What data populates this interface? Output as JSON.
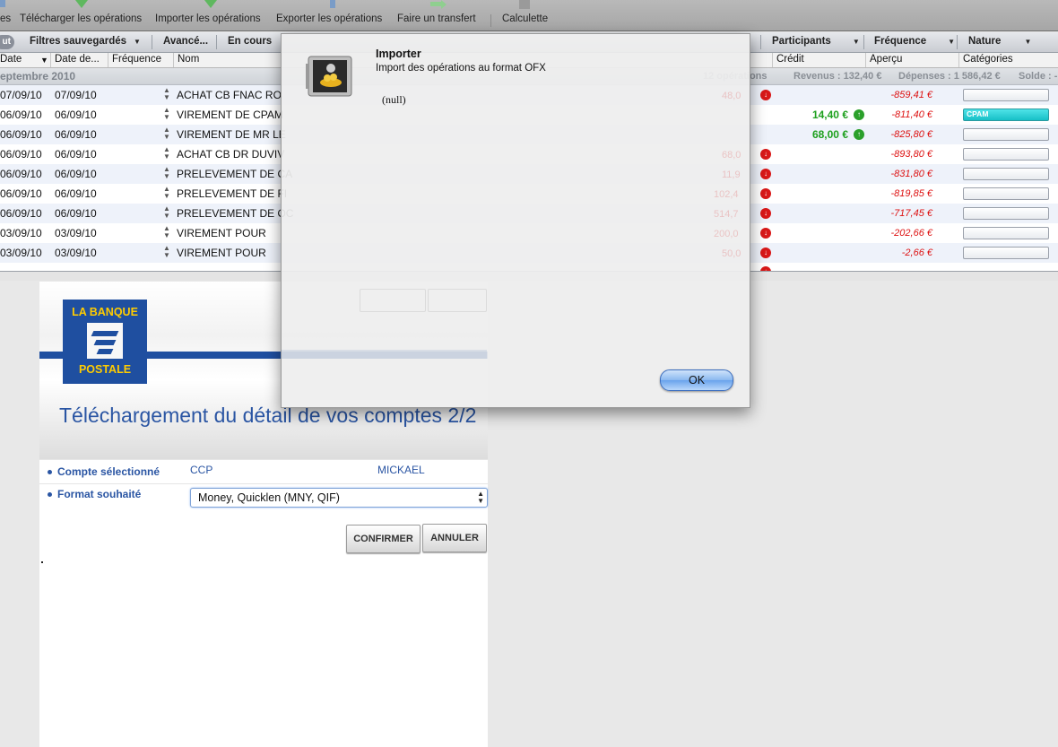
{
  "toolbar": {
    "items": [
      "es",
      "Télécharger les opérations",
      "Importer les opérations",
      "Exporter les opérations",
      "Faire un transfert",
      "Calculette"
    ]
  },
  "filterbar": {
    "pill": "ut",
    "saved_filters": "Filtres sauvegardés",
    "advanced": "Avancé...",
    "in_progress": "En cours",
    "participants": "Participants",
    "frequency": "Fréquence",
    "nature": "Nature"
  },
  "columns": {
    "date": "Date",
    "date_value": "Date de...",
    "frequency": "Fréquence",
    "name": "Nom",
    "credit": "Crédit",
    "preview": "Aperçu",
    "categories": "Catégories"
  },
  "month": {
    "label": "eptembre 2010",
    "ops": "12 opérations",
    "revenue": "Revenus : 132,40 €",
    "expenses": "Dépenses : 1 586,42 €",
    "balance": "Solde : -"
  },
  "rows": [
    {
      "date": "07/09/10",
      "date2": "07/09/10",
      "name": "ACHAT CB FNAC RO",
      "ghost_amount": "48,0",
      "credit": "",
      "balance": "-859,41 €",
      "category": ""
    },
    {
      "date": "06/09/10",
      "date2": "06/09/10",
      "name": "VIREMENT DE CPAM",
      "ghost_amount": "",
      "credit": "14,40 €",
      "balance": "-811,40 €",
      "category": "CPAM"
    },
    {
      "date": "06/09/10",
      "date2": "06/09/10",
      "name": "VIREMENT DE MR LE",
      "ghost_amount": "",
      "credit": "68,00 €",
      "balance": "-825,80 €",
      "category": ""
    },
    {
      "date": "06/09/10",
      "date2": "06/09/10",
      "name": "ACHAT CB DR DUVIV",
      "ghost_amount": "68,0",
      "credit": "",
      "balance": "-893,80 €",
      "category": ""
    },
    {
      "date": "06/09/10",
      "date2": "06/09/10",
      "name": "PRELEVEMENT DE CA",
      "ghost_amount": "11,9",
      "credit": "",
      "balance": "-831,80 €",
      "category": ""
    },
    {
      "date": "06/09/10",
      "date2": "06/09/10",
      "name": "PRELEVEMENT DE FI",
      "ghost_amount": "102,4",
      "credit": "",
      "balance": "-819,85 €",
      "category": ""
    },
    {
      "date": "06/09/10",
      "date2": "06/09/10",
      "name": "PRELEVEMENT DE OC",
      "ghost_amount": "514,7",
      "credit": "",
      "balance": "-717,45 €",
      "category": ""
    },
    {
      "date": "03/09/10",
      "date2": "03/09/10",
      "name": "VIREMENT POUR",
      "ghost_amount": "200,0",
      "credit": "",
      "balance": "-202,66 €",
      "category": ""
    },
    {
      "date": "03/09/10",
      "date2": "03/09/10",
      "name": "VIREMENT POUR",
      "ghost_amount": "50,0",
      "credit": "",
      "balance": "-2,66 €",
      "category": ""
    }
  ],
  "dialog": {
    "title": "Importer",
    "subtitle": "Import des opérations au format OFX",
    "message": "(null)",
    "ok": "OK"
  },
  "bank": {
    "logo_top": "LA BANQUE",
    "logo_bottom": "POSTALE",
    "title": "Téléchargement du détail de vos comptes 2/2",
    "account_label": "Compte sélectionné",
    "account_type": "CCP",
    "account_name": "MICKAEL",
    "format_label": "Format souhaité",
    "format_value": "Money, Quicklen (MNY, QIF)",
    "confirm": "CONFIRMER",
    "cancel": "ANNULER"
  }
}
